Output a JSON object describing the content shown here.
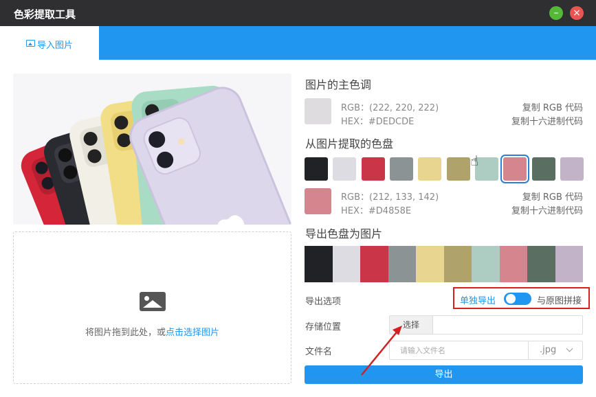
{
  "window": {
    "title": "色彩提取工具",
    "minimize_glyph": "–",
    "close_glyph": "×"
  },
  "tabs": [
    {
      "label": "导入图片",
      "icon": "image-icon",
      "active": true
    }
  ],
  "dropzone": {
    "text": "将图片拖到此处，或",
    "link": "点击选择图片",
    "icon": "image-icon"
  },
  "dominant": {
    "title": "图片的主色调",
    "color": "#DEDCDE",
    "rgb_label": "RGB：(222, 220, 222)",
    "hex_label": "HEX：#DEDCDE",
    "copy_rgb": "复制 RGB 代码",
    "copy_hex": "复制十六进制代码"
  },
  "palette": {
    "title": "从图片提取的色盘",
    "colors": [
      "#212226",
      "#DEDCE3",
      "#CB3548",
      "#8C9394",
      "#E8D690",
      "#AFA36B",
      "#ADCCC2",
      "#D4858E",
      "#5A6E62",
      "#C2B3C8"
    ],
    "selected_index": 7
  },
  "selected": {
    "color": "#D4858E",
    "rgb_label": "RGB：(212, 133, 142)",
    "hex_label": "HEX：#D4858E",
    "copy_rgb": "复制 RGB 代码",
    "copy_hex": "复制十六进制代码"
  },
  "export": {
    "title": "导出色盘为图片",
    "options_label": "导出选项",
    "option_single": "单独导出",
    "option_join": "与原图拼接",
    "toggle_state": "单独导出",
    "storage_label": "存储位置",
    "choose_button": "选择",
    "filename_label": "文件名",
    "filename_placeholder": "请输入文件名",
    "extension": ".jpg",
    "export_button": "导出"
  },
  "colors": {
    "accent": "#2196F0",
    "titlebar": "#2F2F31",
    "highlight_box": "#D42020"
  }
}
